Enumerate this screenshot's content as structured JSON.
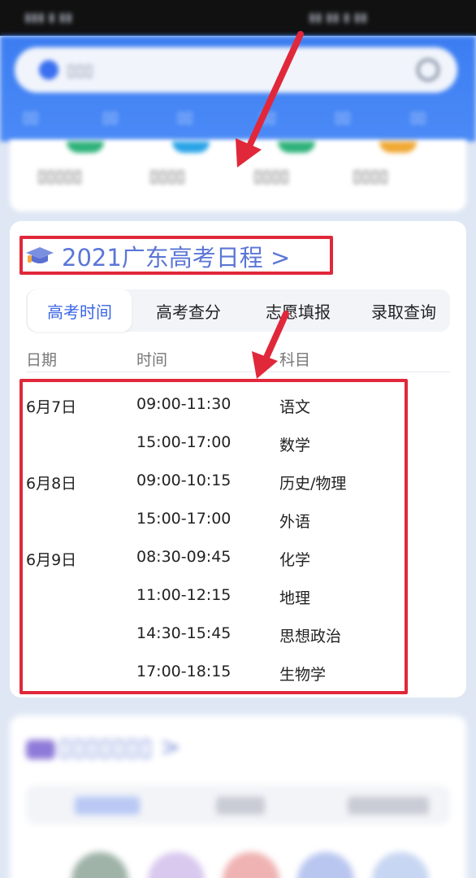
{
  "card": {
    "title": "2021广东高考日程 >",
    "tabs": [
      "高考时间",
      "高考查分",
      "志愿填报",
      "录取查询"
    ],
    "active_tab": "高考时间",
    "columns": [
      "日期",
      "时间",
      "科目"
    ],
    "rows": [
      {
        "date": "6月7日",
        "time": "09:00-11:30",
        "subject": "语文"
      },
      {
        "date": "",
        "time": "15:00-17:00",
        "subject": "数学"
      },
      {
        "date": "6月8日",
        "time": "09:00-10:15",
        "subject": "历史/物理"
      },
      {
        "date": "",
        "time": "15:00-17:00",
        "subject": "外语"
      },
      {
        "date": "6月9日",
        "time": "08:30-09:45",
        "subject": "化学"
      },
      {
        "date": "",
        "time": "11:00-12:15",
        "subject": "地理"
      },
      {
        "date": "",
        "time": "14:30-15:45",
        "subject": "思想政治"
      },
      {
        "date": "",
        "time": "17:00-18:15",
        "subject": "生物学"
      }
    ]
  },
  "colors": {
    "accent": "#3a66e6",
    "title": "#5b76d6",
    "highlight": "#e0283a"
  },
  "icons": [
    "graduation-cap-icon",
    "arrow-icon"
  ]
}
